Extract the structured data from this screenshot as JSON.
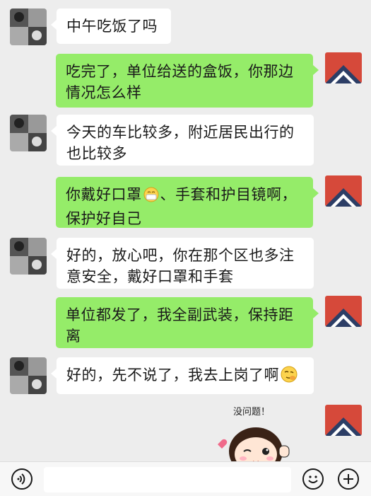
{
  "messages": [
    {
      "side": "in",
      "text_lines": [
        "中午吃饭了吗"
      ]
    },
    {
      "side": "out",
      "text_lines": [
        "吃完了，单位给送的盒饭，你那边",
        "情况怎么样"
      ]
    },
    {
      "side": "in",
      "text_lines": [
        "今天的车比较多，附近居民出行的",
        "也比较多"
      ]
    },
    {
      "side": "out",
      "text_lines_pre": "你戴好口罩",
      "emoji": "mask-face",
      "text_lines_post": "、手套和护目镜啊，",
      "line2": "保护好自己"
    },
    {
      "side": "in",
      "text_lines": [
        "好的，放心吧，你在那个区也多注",
        "意安全，戴好口罩和手套"
      ]
    },
    {
      "side": "out",
      "text_lines": [
        "单位都发了，我全副武装，保持距",
        "离"
      ]
    },
    {
      "side": "in",
      "text_pre": "好的，先不说了，我去上岗了啊",
      "emoji": "smirk-face"
    }
  ],
  "sticker": {
    "caption": "没问题！",
    "name": "cartoon-girl-wink-sticker"
  },
  "input": {
    "placeholder": ""
  },
  "colors": {
    "background": "#ededed",
    "bubble_out": "#95ec69",
    "bubble_in": "#ffffff"
  }
}
